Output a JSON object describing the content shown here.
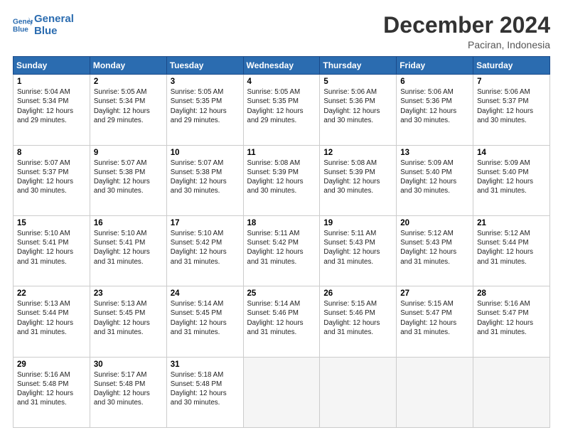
{
  "header": {
    "logo_line1": "General",
    "logo_line2": "Blue",
    "title": "December 2024",
    "subtitle": "Paciran, Indonesia"
  },
  "columns": [
    "Sunday",
    "Monday",
    "Tuesday",
    "Wednesday",
    "Thursday",
    "Friday",
    "Saturday"
  ],
  "weeks": [
    [
      {
        "day": "1",
        "sunrise": "5:04 AM",
        "sunset": "5:34 PM",
        "daylight": "12 hours and 29 minutes."
      },
      {
        "day": "2",
        "sunrise": "5:05 AM",
        "sunset": "5:34 PM",
        "daylight": "12 hours and 29 minutes."
      },
      {
        "day": "3",
        "sunrise": "5:05 AM",
        "sunset": "5:35 PM",
        "daylight": "12 hours and 29 minutes."
      },
      {
        "day": "4",
        "sunrise": "5:05 AM",
        "sunset": "5:35 PM",
        "daylight": "12 hours and 29 minutes."
      },
      {
        "day": "5",
        "sunrise": "5:06 AM",
        "sunset": "5:36 PM",
        "daylight": "12 hours and 30 minutes."
      },
      {
        "day": "6",
        "sunrise": "5:06 AM",
        "sunset": "5:36 PM",
        "daylight": "12 hours and 30 minutes."
      },
      {
        "day": "7",
        "sunrise": "5:06 AM",
        "sunset": "5:37 PM",
        "daylight": "12 hours and 30 minutes."
      }
    ],
    [
      {
        "day": "8",
        "sunrise": "5:07 AM",
        "sunset": "5:37 PM",
        "daylight": "12 hours and 30 minutes."
      },
      {
        "day": "9",
        "sunrise": "5:07 AM",
        "sunset": "5:38 PM",
        "daylight": "12 hours and 30 minutes."
      },
      {
        "day": "10",
        "sunrise": "5:07 AM",
        "sunset": "5:38 PM",
        "daylight": "12 hours and 30 minutes."
      },
      {
        "day": "11",
        "sunrise": "5:08 AM",
        "sunset": "5:39 PM",
        "daylight": "12 hours and 30 minutes."
      },
      {
        "day": "12",
        "sunrise": "5:08 AM",
        "sunset": "5:39 PM",
        "daylight": "12 hours and 30 minutes."
      },
      {
        "day": "13",
        "sunrise": "5:09 AM",
        "sunset": "5:40 PM",
        "daylight": "12 hours and 30 minutes."
      },
      {
        "day": "14",
        "sunrise": "5:09 AM",
        "sunset": "5:40 PM",
        "daylight": "12 hours and 31 minutes."
      }
    ],
    [
      {
        "day": "15",
        "sunrise": "5:10 AM",
        "sunset": "5:41 PM",
        "daylight": "12 hours and 31 minutes."
      },
      {
        "day": "16",
        "sunrise": "5:10 AM",
        "sunset": "5:41 PM",
        "daylight": "12 hours and 31 minutes."
      },
      {
        "day": "17",
        "sunrise": "5:10 AM",
        "sunset": "5:42 PM",
        "daylight": "12 hours and 31 minutes."
      },
      {
        "day": "18",
        "sunrise": "5:11 AM",
        "sunset": "5:42 PM",
        "daylight": "12 hours and 31 minutes."
      },
      {
        "day": "19",
        "sunrise": "5:11 AM",
        "sunset": "5:43 PM",
        "daylight": "12 hours and 31 minutes."
      },
      {
        "day": "20",
        "sunrise": "5:12 AM",
        "sunset": "5:43 PM",
        "daylight": "12 hours and 31 minutes."
      },
      {
        "day": "21",
        "sunrise": "5:12 AM",
        "sunset": "5:44 PM",
        "daylight": "12 hours and 31 minutes."
      }
    ],
    [
      {
        "day": "22",
        "sunrise": "5:13 AM",
        "sunset": "5:44 PM",
        "daylight": "12 hours and 31 minutes."
      },
      {
        "day": "23",
        "sunrise": "5:13 AM",
        "sunset": "5:45 PM",
        "daylight": "12 hours and 31 minutes."
      },
      {
        "day": "24",
        "sunrise": "5:14 AM",
        "sunset": "5:45 PM",
        "daylight": "12 hours and 31 minutes."
      },
      {
        "day": "25",
        "sunrise": "5:14 AM",
        "sunset": "5:46 PM",
        "daylight": "12 hours and 31 minutes."
      },
      {
        "day": "26",
        "sunrise": "5:15 AM",
        "sunset": "5:46 PM",
        "daylight": "12 hours and 31 minutes."
      },
      {
        "day": "27",
        "sunrise": "5:15 AM",
        "sunset": "5:47 PM",
        "daylight": "12 hours and 31 minutes."
      },
      {
        "day": "28",
        "sunrise": "5:16 AM",
        "sunset": "5:47 PM",
        "daylight": "12 hours and 31 minutes."
      }
    ],
    [
      {
        "day": "29",
        "sunrise": "5:16 AM",
        "sunset": "5:48 PM",
        "daylight": "12 hours and 31 minutes."
      },
      {
        "day": "30",
        "sunrise": "5:17 AM",
        "sunset": "5:48 PM",
        "daylight": "12 hours and 30 minutes."
      },
      {
        "day": "31",
        "sunrise": "5:18 AM",
        "sunset": "5:48 PM",
        "daylight": "12 hours and 30 minutes."
      },
      null,
      null,
      null,
      null
    ]
  ],
  "labels": {
    "sunrise": "Sunrise:",
    "sunset": "Sunset:",
    "daylight": "Daylight:"
  }
}
